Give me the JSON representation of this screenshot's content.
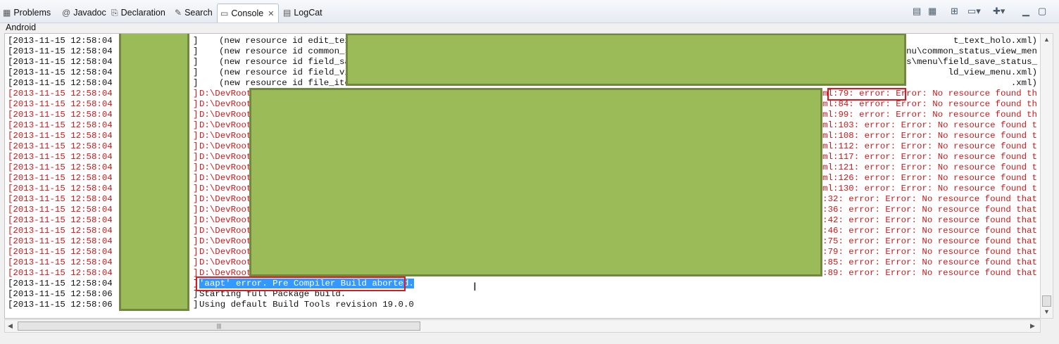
{
  "tabs": [
    {
      "label": "Problems",
      "icon": "▦"
    },
    {
      "label": "Javadoc",
      "icon": "@"
    },
    {
      "label": "Declaration",
      "icon": "⎘"
    },
    {
      "label": "Search",
      "icon": "✎"
    },
    {
      "label": "Console",
      "icon": "▭",
      "close": "✕"
    },
    {
      "label": "LogCat",
      "icon": "▤"
    }
  ],
  "toolbar": {
    "icons": [
      "clear-console-icon",
      "scroll-lock-icon",
      "pin-console-icon",
      "display-console-icon",
      "open-console-icon",
      "minimize-icon",
      "maximize-icon"
    ]
  },
  "console": {
    "title": "Android",
    "lines": [
      {
        "ts": "[2013-11-15 12:58:04 -",
        "text": "(new resource id edit_text",
        "tail": "t_text_holo.xml)",
        "type": "info"
      },
      {
        "ts": "[2013-11-15 12:58:04 -",
        "text": "(new resource id common_st",
        "tail": "menu\\common_status_view_men",
        "type": "info"
      },
      {
        "ts": "[2013-11-15 12:58:04 -",
        "text": "(new resource id field_sav",
        "tail": "res\\menu\\field_save_status_",
        "type": "info"
      },
      {
        "ts": "[2013-11-15 12:58:04 -",
        "text": "(new resource id field_vie",
        "tail": "ld_view_menu.xml)",
        "type": "info"
      },
      {
        "ts": "[2013-11-15 12:58:04 -",
        "text": "(new resource id file_item",
        "tail": ".xml)",
        "type": "info"
      },
      {
        "ts": "[2013-11-15 12:58:04 -",
        "text": "D:\\DevRoot",
        "tail": "on.xml:79: error: Error: No resource found th",
        "type": "error"
      },
      {
        "ts": "[2013-11-15 12:58:04 -",
        "text": "D:\\DevRoot",
        "tail": "on.xml:84: error: Error: No resource found th",
        "type": "error"
      },
      {
        "ts": "[2013-11-15 12:58:04 -",
        "text": "D:\\DevRoot",
        "tail": "on.xml:99: error: Error: No resource found th",
        "type": "error"
      },
      {
        "ts": "[2013-11-15 12:58:04 -",
        "text": "D:\\DevRoot",
        "tail": "on.xml:103: error: Error: No resource found t",
        "type": "error"
      },
      {
        "ts": "[2013-11-15 12:58:04 -",
        "text": "D:\\DevRoot",
        "tail": "on.xml:108: error: Error: No resource found t",
        "type": "error"
      },
      {
        "ts": "[2013-11-15 12:58:04 -",
        "text": "D:\\DevRoot",
        "tail": "on.xml:112: error: Error: No resource found t",
        "type": "error"
      },
      {
        "ts": "[2013-11-15 12:58:04 -",
        "text": "D:\\DevRoot",
        "tail": "on.xml:117: error: Error: No resource found t",
        "type": "error"
      },
      {
        "ts": "[2013-11-15 12:58:04 -",
        "text": "D:\\DevRoot",
        "tail": "on.xml:121: error: Error: No resource found t",
        "type": "error"
      },
      {
        "ts": "[2013-11-15 12:58:04 -",
        "text": "D:\\DevRoot",
        "tail": "on.xml:126: error: Error: No resource found t",
        "type": "error"
      },
      {
        "ts": "[2013-11-15 12:58:04 -",
        "text": "D:\\DevRoot",
        "tail": "on.xml:130: error: Error: No resource found t",
        "type": "error"
      },
      {
        "ts": "[2013-11-15 12:58:04 -",
        "text": "D:\\DevRoot",
        "tail": ".xml:32: error: Error: No resource found that",
        "type": "error"
      },
      {
        "ts": "[2013-11-15 12:58:04 -",
        "text": "D:\\DevRoot",
        "tail": ".xml:36: error: Error: No resource found that",
        "type": "error"
      },
      {
        "ts": "[2013-11-15 12:58:04 -",
        "text": "D:\\DevRoot",
        "tail": ".xml:42: error: Error: No resource found that",
        "type": "error"
      },
      {
        "ts": "[2013-11-15 12:58:04 -",
        "text": "D:\\DevRoot",
        "tail": ".xml:46: error: Error: No resource found that",
        "type": "error"
      },
      {
        "ts": "[2013-11-15 12:58:04 -",
        "text": "D:\\DevRoot",
        "tail": ".xml:75: error: Error: No resource found that",
        "type": "error"
      },
      {
        "ts": "[2013-11-15 12:58:04 -",
        "text": "D:\\DevRoot",
        "tail": ".xml:79: error: Error: No resource found that",
        "type": "error"
      },
      {
        "ts": "[2013-11-15 12:58:04 -",
        "text": "D:\\DevRoot",
        "tail": ".xml:85: error: Error: No resource found that",
        "type": "error"
      },
      {
        "ts": "[2013-11-15 12:58:04 -",
        "text": "D:\\DevRoot",
        "tail": ".xml:89: error: Error: No resource found that",
        "type": "error"
      },
      {
        "ts": "[2013-11-15 12:58:04 -",
        "text": "'aapt' error. Pre Compiler Build aborted.",
        "tail": "",
        "type": "selected"
      },
      {
        "ts": "[2013-11-15 12:58:06 -",
        "text": "Starting full Package build.",
        "tail": "",
        "type": "info"
      },
      {
        "ts": "[2013-11-15 12:58:06 -",
        "text": "Using default Build Tools revision 19.0.0",
        "tail": "",
        "type": "info"
      }
    ]
  },
  "scrollbar": {
    "grip": "|||"
  }
}
